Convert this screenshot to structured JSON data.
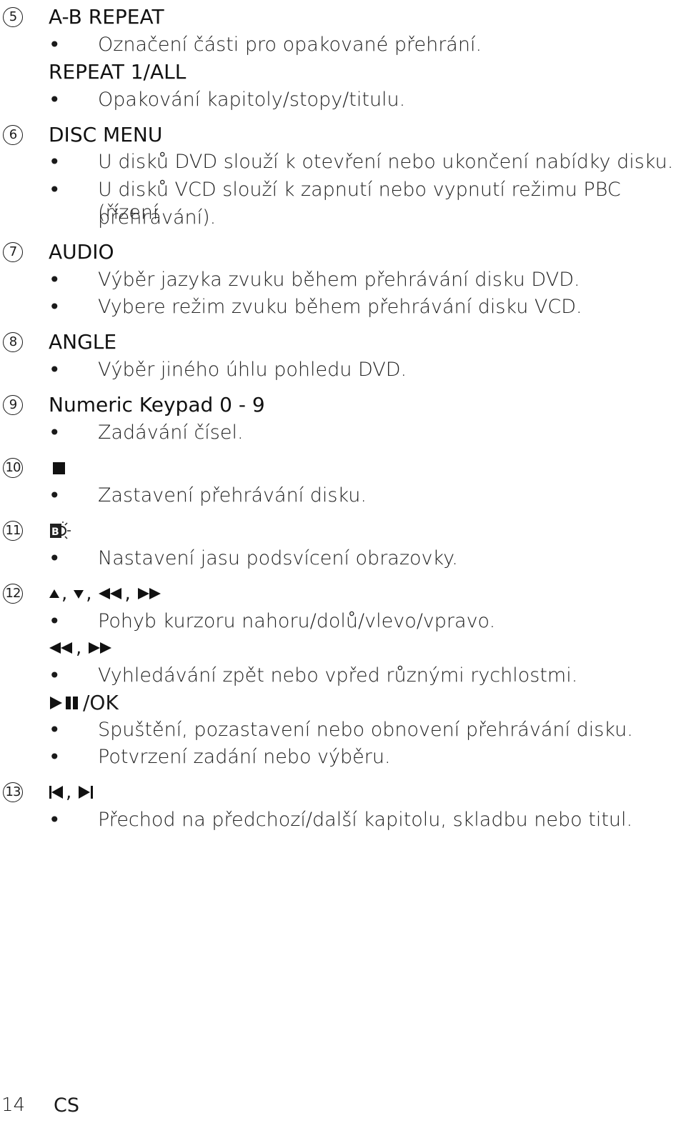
{
  "items": [
    {
      "number": "5",
      "heading": "A-B REPEAT",
      "bullets": [
        "Označení části pro opakované přehrání."
      ],
      "subheading": "REPEAT 1/ALL",
      "sub_bullets": [
        "Opakování kapitoly/stopy/titulu."
      ]
    },
    {
      "number": "6",
      "heading": "DISC MENU",
      "bullets": [
        "U disků DVD slouží k otevření nebo ukončení nabídky disku.",
        "U disků VCD slouží k zapnutí nebo vypnutí režimu PBC (řízení",
        "přehrávání)."
      ]
    },
    {
      "number": "7",
      "heading": "AUDIO",
      "bullets": [
        "Výběr jazyka zvuku během přehrávání disku DVD.",
        "Vybere režim zvuku během přehrávání disku VCD."
      ]
    },
    {
      "number": "8",
      "heading": "ANGLE",
      "bullets": [
        "Výběr jiného úhlu pohledu DVD."
      ]
    },
    {
      "number": "9",
      "heading": "Numeric Keypad 0 - 9",
      "bullets": [
        "Zadávání čísel."
      ]
    },
    {
      "number": "10",
      "icon": "stop-icon",
      "bullets": [
        "Zastavení přehrávání disku."
      ]
    },
    {
      "number": "11",
      "icon": "backlight-brightness-icon",
      "bullets": [
        "Nastavení jasu podsvícení obrazovky."
      ]
    },
    {
      "number": "12",
      "icons": [
        "up-icon",
        "down-icon",
        "rewind-icon",
        "fast-forward-icon"
      ],
      "bullets": [
        "Pohyb kurzoru nahoru/dolů/vlevo/vpravo."
      ],
      "sub1_icons": [
        "rewind-icon",
        "fast-forward-icon"
      ],
      "sub1_bullets": [
        "Vyhledávání zpět nebo vpřed různými rychlostmi."
      ],
      "sub2_label": "/OK",
      "sub2_bullets": [
        "Spuštění, pozastavení nebo obnovení přehrávání disku.",
        "Potvrzení zadání nebo výběru."
      ]
    },
    {
      "number": "13",
      "icons": [
        "previous-icon",
        "next-icon"
      ],
      "bullets": [
        "Přechod na předchozí/další kapitolu, skladbu nebo titul."
      ]
    }
  ],
  "bullet_char": "•",
  "comma": ",",
  "footer": {
    "page_number": "14",
    "language": "CS"
  }
}
